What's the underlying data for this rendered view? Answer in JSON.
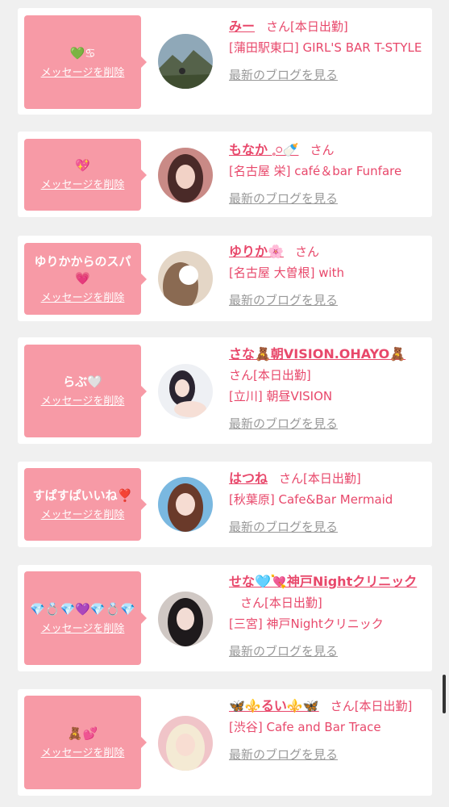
{
  "posts": [
    {
      "message": "💚♋",
      "delete_label": "メッセージを削除",
      "name": "みー",
      "san": "さん[本日出勤]",
      "shop": "[蒲田駅東口] GIRL'S BAR T-STYLE",
      "blog_label": "最新のブログを見る",
      "avatar_icon": "avatar-photo"
    },
    {
      "message": "💖",
      "delete_label": "メッセージを削除",
      "name": "もなか 𓈒𓏸🍼",
      "san": "さん",
      "shop": "[名古屋 栄] café＆bar Funfare",
      "blog_label": "最新のブログを見る",
      "avatar_icon": "avatar-photo"
    },
    {
      "message": "ゆりかからのスパ💗",
      "delete_label": "メッセージを削除",
      "name": "ゆりか🌸",
      "san": "さん",
      "shop": "[名古屋 大曽根] with",
      "blog_label": "最新のブログを見る",
      "avatar_icon": "avatar-photo"
    },
    {
      "message": "らぶ🤍",
      "delete_label": "メッセージを削除",
      "name": "さな🧸朝VISION.OHAYO🧸",
      "san": "さん[本日出勤]",
      "shop": "[立川] 朝昼VISION",
      "blog_label": "最新のブログを見る",
      "avatar_icon": "avatar-photo"
    },
    {
      "message": "すぱすぱいいね❣️",
      "delete_label": "メッセージを削除",
      "name": "はつね",
      "san": "さん[本日出勤]",
      "shop": "[秋葉原] Cafe&Bar Mermaid",
      "blog_label": "最新のブログを見る",
      "avatar_icon": "avatar-photo"
    },
    {
      "message": "💎💍💎💜💎💍💎",
      "delete_label": "メッセージを削除",
      "name": "せな🩵💘神戸Nightクリニック",
      "san": "さん[本日出勤]",
      "shop": "[三宮] 神戸Nightクリニック",
      "blog_label": "最新のブログを見る",
      "avatar_icon": "avatar-photo"
    },
    {
      "message": "🧸💕",
      "delete_label": "メッセージを削除",
      "name": "🦋⚜️るい⚜️🦋",
      "san": "さん[本日出勤]",
      "shop": "[渋谷] Cafe and Bar Trace",
      "blog_label": "最新のブログを見る",
      "avatar_icon": "avatar-photo"
    }
  ],
  "colors": {
    "accent": "#e8486b",
    "bubble": "#f79aa6",
    "link_gray": "#999999",
    "background": "#f0f0f0"
  }
}
